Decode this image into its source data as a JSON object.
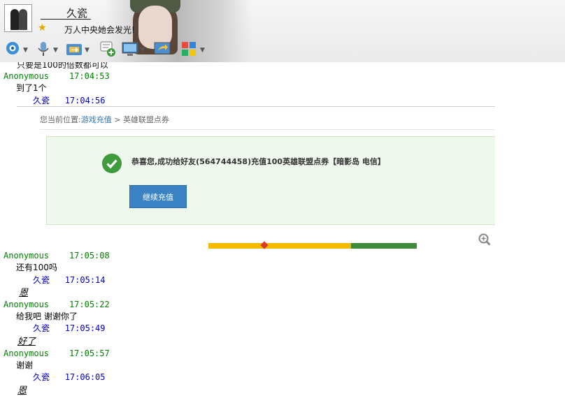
{
  "header": {
    "contact_name": "久瓷",
    "signature": "万人中央她会发光!"
  },
  "toolbar": {
    "icons": [
      "video-call-icon",
      "voice-call-icon",
      "file-transfer-icon",
      "add-chat-icon",
      "remote-desktop-icon",
      "share-screen-icon",
      "apps-icon"
    ]
  },
  "chat": {
    "clipped_message": "只要是100的倍数都可以",
    "messages": [
      {
        "sender": "Anonymous",
        "time": "17:04:53",
        "text": "到了1个",
        "style": "plain"
      },
      {
        "sender": "久瓷",
        "time": "17:04:56",
        "text": "",
        "style": "plain"
      },
      {
        "sender": "Anonymous",
        "time": "17:05:08",
        "text": "还有100吗",
        "style": "plain"
      },
      {
        "sender": "久瓷",
        "time": "17:05:14",
        "text": "恩",
        "style": "emph"
      },
      {
        "sender": "Anonymous",
        "time": "17:05:22",
        "text": "给我吧 谢谢你了",
        "style": "plain"
      },
      {
        "sender": "久瓷",
        "time": "17:05:49",
        "text": "好了",
        "style": "emph"
      },
      {
        "sender": "Anonymous",
        "time": "17:05:57",
        "text": "谢谢",
        "style": "plain"
      },
      {
        "sender": "久瓷",
        "time": "17:06:05",
        "text": "恩",
        "style": "emph"
      }
    ]
  },
  "screenshot": {
    "breadcrumb_prefix": "您当前位置:",
    "breadcrumb_link": "游戏充值",
    "breadcrumb_sep": " > ",
    "breadcrumb_current": "英雄联盟点券",
    "success_text": "恭喜您,成功给好友(564744458)充值100英雄联盟点券【暗影岛 电信】",
    "continue_label": "继续充值"
  },
  "colors": {
    "anon_name": "#008000",
    "self_name": "#0000c8",
    "success_green": "#3f9b3c",
    "button_blue": "#3a82c4"
  }
}
